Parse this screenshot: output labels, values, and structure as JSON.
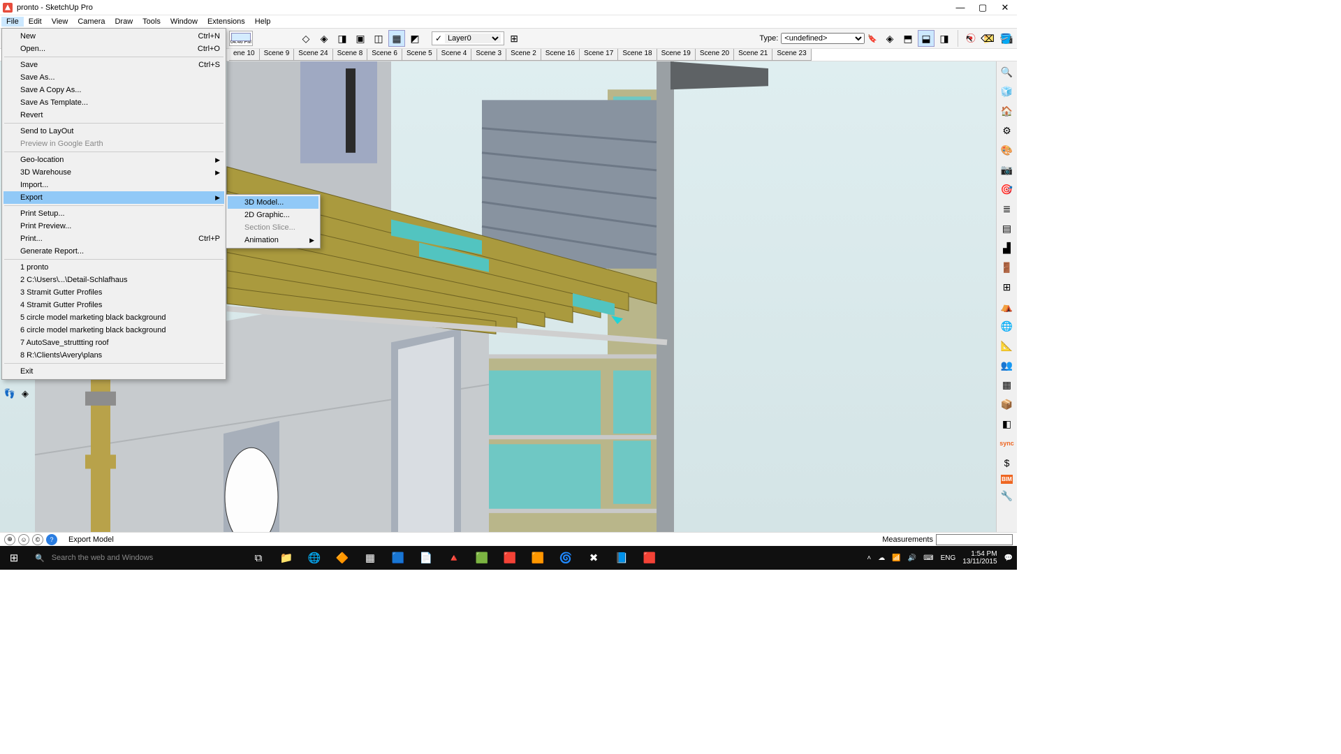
{
  "window": {
    "title": "pronto - SketchUp Pro"
  },
  "menubar": [
    "File",
    "Edit",
    "View",
    "Camera",
    "Draw",
    "Tools",
    "Window",
    "Extensions",
    "Help"
  ],
  "activeMenu": 0,
  "toolbar": {
    "clockTime": "04:46 PM",
    "layerLabel": "Layer0",
    "typeLabel": "Type:",
    "typeValue": "<undefined>"
  },
  "sceneTabs": [
    "ene 10",
    "Scene 9",
    "Scene 24",
    "Scene 8",
    "Scene 6",
    "Scene 5",
    "Scene 4",
    "Scene 3",
    "Scene 2",
    "Scene 16",
    "Scene 17",
    "Scene 18",
    "Scene 19",
    "Scene 20",
    "Scene 21",
    "Scene 23"
  ],
  "fileMenu": {
    "groups": [
      [
        {
          "label": "New",
          "shortcut": "Ctrl+N"
        },
        {
          "label": "Open...",
          "shortcut": "Ctrl+O"
        }
      ],
      [
        {
          "label": "Save",
          "shortcut": "Ctrl+S"
        },
        {
          "label": "Save As..."
        },
        {
          "label": "Save A Copy As..."
        },
        {
          "label": "Save As Template..."
        },
        {
          "label": "Revert"
        }
      ],
      [
        {
          "label": "Send to LayOut"
        },
        {
          "label": "Preview in Google Earth",
          "disabled": true
        }
      ],
      [
        {
          "label": "Geo-location",
          "submenu": true
        },
        {
          "label": "3D Warehouse",
          "submenu": true
        },
        {
          "label": "Import..."
        },
        {
          "label": "Export",
          "submenu": true,
          "highlight": true
        }
      ],
      [
        {
          "label": "Print Setup..."
        },
        {
          "label": "Print Preview..."
        },
        {
          "label": "Print...",
          "shortcut": "Ctrl+P"
        },
        {
          "label": "Generate Report..."
        }
      ],
      [
        {
          "label": "1 pronto"
        },
        {
          "label": "2 C:\\Users\\...\\Detail-Schlafhaus"
        },
        {
          "label": "3 Stramit Gutter Profiles"
        },
        {
          "label": "4 Stramit Gutter Profiles"
        },
        {
          "label": "5 circle model marketing black background"
        },
        {
          "label": "6 circle model marketing black background"
        },
        {
          "label": "7 AutoSave_struttting roof"
        },
        {
          "label": "8 R:\\Clients\\Avery\\plans"
        }
      ],
      [
        {
          "label": "Exit"
        }
      ]
    ]
  },
  "exportSubmenu": [
    {
      "label": "3D Model...",
      "highlight": true
    },
    {
      "label": "2D Graphic..."
    },
    {
      "label": "Section Slice...",
      "disabled": true
    },
    {
      "label": "Animation",
      "submenu": true
    }
  ],
  "status": {
    "text": "Export Model",
    "measurementsLabel": "Measurements"
  },
  "taskbar": {
    "searchPlaceholder": "Search the web and Windows",
    "lang": "ENG",
    "time": "1:54 PM",
    "date": "13/11/2015"
  },
  "rightTray": {
    "sync": "sync",
    "bim": "BIM"
  }
}
